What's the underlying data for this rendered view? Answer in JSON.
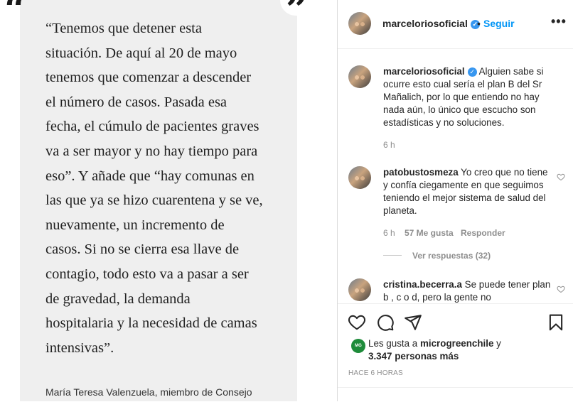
{
  "post_image": {
    "open_quote": "“",
    "close_quote": "”",
    "article_text": "“Tenemos que detener esta\nsituación. De aquí al 20 de mayo\ntenemos que comenzar a descender\nel número de casos. Pasada esa\nfecha, el cúmulo de pacientes graves\nva a ser mayor y no hay tiempo para\neso”. Y añade que “hay comunas en\nlas que ya se hizo cuarentena y se ve,\nnuevamente, un incremento de\ncasos. Si no se cierra esa llave de\ncontagio, todo esto va a pasar a ser\nde gravedad, la demanda\nhospitalaria y la necesidad de camas\nintensivas”.",
    "caption": "María Teresa Valenzuela, miembro de Consejo"
  },
  "header": {
    "username": "marceloriosoficial",
    "separator": "•",
    "follow_label": "Seguir",
    "more_label": "•••",
    "icons": {
      "verified": "verified-badge-icon",
      "more": "more-options-icon"
    }
  },
  "comments": [
    {
      "username": "marceloriosoficial",
      "text": "Alguien sabe si ocurre esto cual sería el plan B del Sr Mañalich, por lo que entiendo no hay nada aún, lo único que escucho son estadísticas y no soluciones.",
      "time": "6 h"
    },
    {
      "username": "patobustosmeza",
      "text": "Yo creo que no tiene y confía ciegamente en que seguimos teniendo el mejor sistema de salud del planeta.",
      "time": "6 h",
      "likes": "57 Me gusta",
      "reply_label": "Responder",
      "view_replies": "Ver respuestas (32)"
    },
    {
      "username": "cristina.becerra.a",
      "text": "Se puede tener plan b , c o d, pero la gente no"
    }
  ],
  "actions": {
    "icons": [
      "heart-icon",
      "comment-icon",
      "share-icon",
      "bookmark-icon"
    ],
    "likes_prefix": "Les gusta a",
    "likes_user": "microgreenchile",
    "likes_conj": "y",
    "likes_others": "3.347 personas más",
    "likes_avatar_text": "MICRO\nGREEN",
    "timestamp": "HACE 6 HORAS"
  },
  "colors": {
    "accent": "#0095f6",
    "verified": "#3897f0",
    "muted": "#8e8e8e",
    "image_bg": "#efefef"
  }
}
